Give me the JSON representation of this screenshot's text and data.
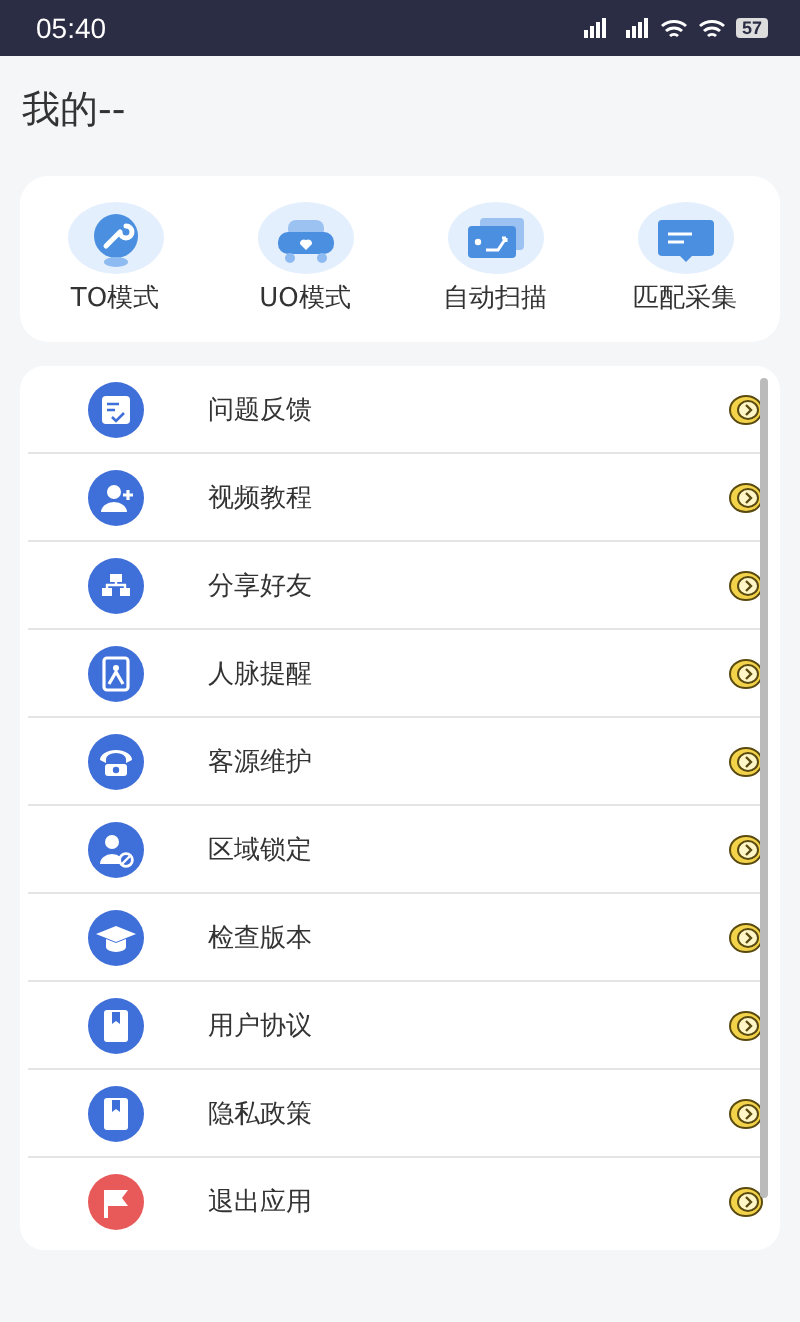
{
  "status_bar": {
    "time": "05:40",
    "battery": "57"
  },
  "header": {
    "title": "我的--"
  },
  "shortcuts": [
    {
      "label": "TO模式",
      "kind": "wrench"
    },
    {
      "label": "UO模式",
      "kind": "car"
    },
    {
      "label": "自动扫描",
      "kind": "scan"
    },
    {
      "label": "匹配采集",
      "kind": "screen"
    }
  ],
  "menu": [
    {
      "label": "问题反馈",
      "kind": "note",
      "color": "#3f6fd8"
    },
    {
      "label": "视频教程",
      "kind": "useradd",
      "color": "#3f6fd8"
    },
    {
      "label": "分享好友",
      "kind": "flow",
      "color": "#3f6fd8"
    },
    {
      "label": "人脉提醒",
      "kind": "image",
      "color": "#3f6fd8"
    },
    {
      "label": "客源维护",
      "kind": "phone",
      "color": "#3f6fd8"
    },
    {
      "label": "区域锁定",
      "kind": "userblock",
      "color": "#3f6fd8"
    },
    {
      "label": "检查版本",
      "kind": "cap",
      "color": "#3f6fd8"
    },
    {
      "label": "用户协议",
      "kind": "book",
      "color": "#3f6fd8"
    },
    {
      "label": "隐私政策",
      "kind": "book",
      "color": "#3f6fd8"
    },
    {
      "label": "退出应用",
      "kind": "flag",
      "color": "#e85a5a"
    }
  ]
}
